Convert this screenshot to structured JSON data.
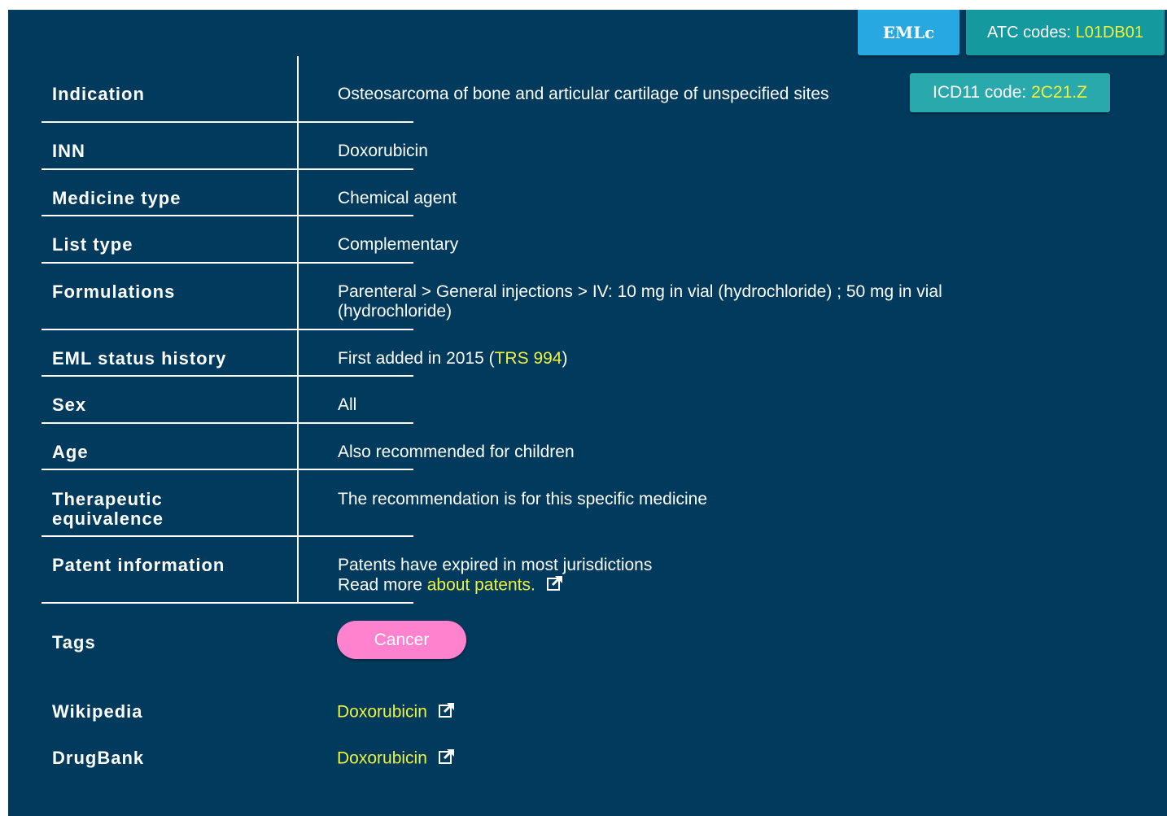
{
  "header": {
    "eml_badge": "EMLc",
    "atc_prefix": "ATC codes: ",
    "atc_code": "L01DB01"
  },
  "rows": {
    "indication": {
      "label": "Indication",
      "value": "Osteosarcoma of bone and articular cartilage of unspecified sites"
    },
    "icd": {
      "prefix": "ICD11 code: ",
      "code": "2C21.Z"
    },
    "inn": {
      "label": "INN",
      "value": "Doxorubicin"
    },
    "medicine_type": {
      "label": "Medicine type",
      "value": "Chemical agent"
    },
    "list_type": {
      "label": "List type",
      "value": "Complementary"
    },
    "formulations": {
      "label": "Formulations",
      "value": "Parenteral > General injections > IV: 10 mg in vial (hydrochloride) ; 50 mg in vial (hydrochloride)"
    },
    "eml_status": {
      "label": "EML status history",
      "prefix": "First added in 2015 (",
      "link": "TRS 994",
      "suffix": ")"
    },
    "sex": {
      "label": "Sex",
      "value": "All"
    },
    "age": {
      "label": "Age",
      "value": "Also recommended for children"
    },
    "therapeutic": {
      "label": "Therapeutic equivalence",
      "value": "The recommendation is for this specific medicine"
    },
    "patent": {
      "label": "Patent information",
      "line1": "Patents have expired in most jurisdictions",
      "read_more": "Read more ",
      "link": "about patents."
    }
  },
  "tags": {
    "label": "Tags",
    "items": [
      "Cancer"
    ]
  },
  "external": {
    "wikipedia": {
      "label": "Wikipedia",
      "link": "Doxorubicin"
    },
    "drugbank": {
      "label": "DrugBank",
      "link": "Doxorubicin"
    }
  },
  "colors": {
    "panel_bg": "#003a5d",
    "link": "#f0f23a",
    "eml_badge_bg": "#27a8e0",
    "atc_badge_bg": "#13999e",
    "icd_badge_bg": "#2aa9ad",
    "tag_bg": "#ff82cf"
  },
  "icons": {
    "external_link": "external-link-icon"
  }
}
